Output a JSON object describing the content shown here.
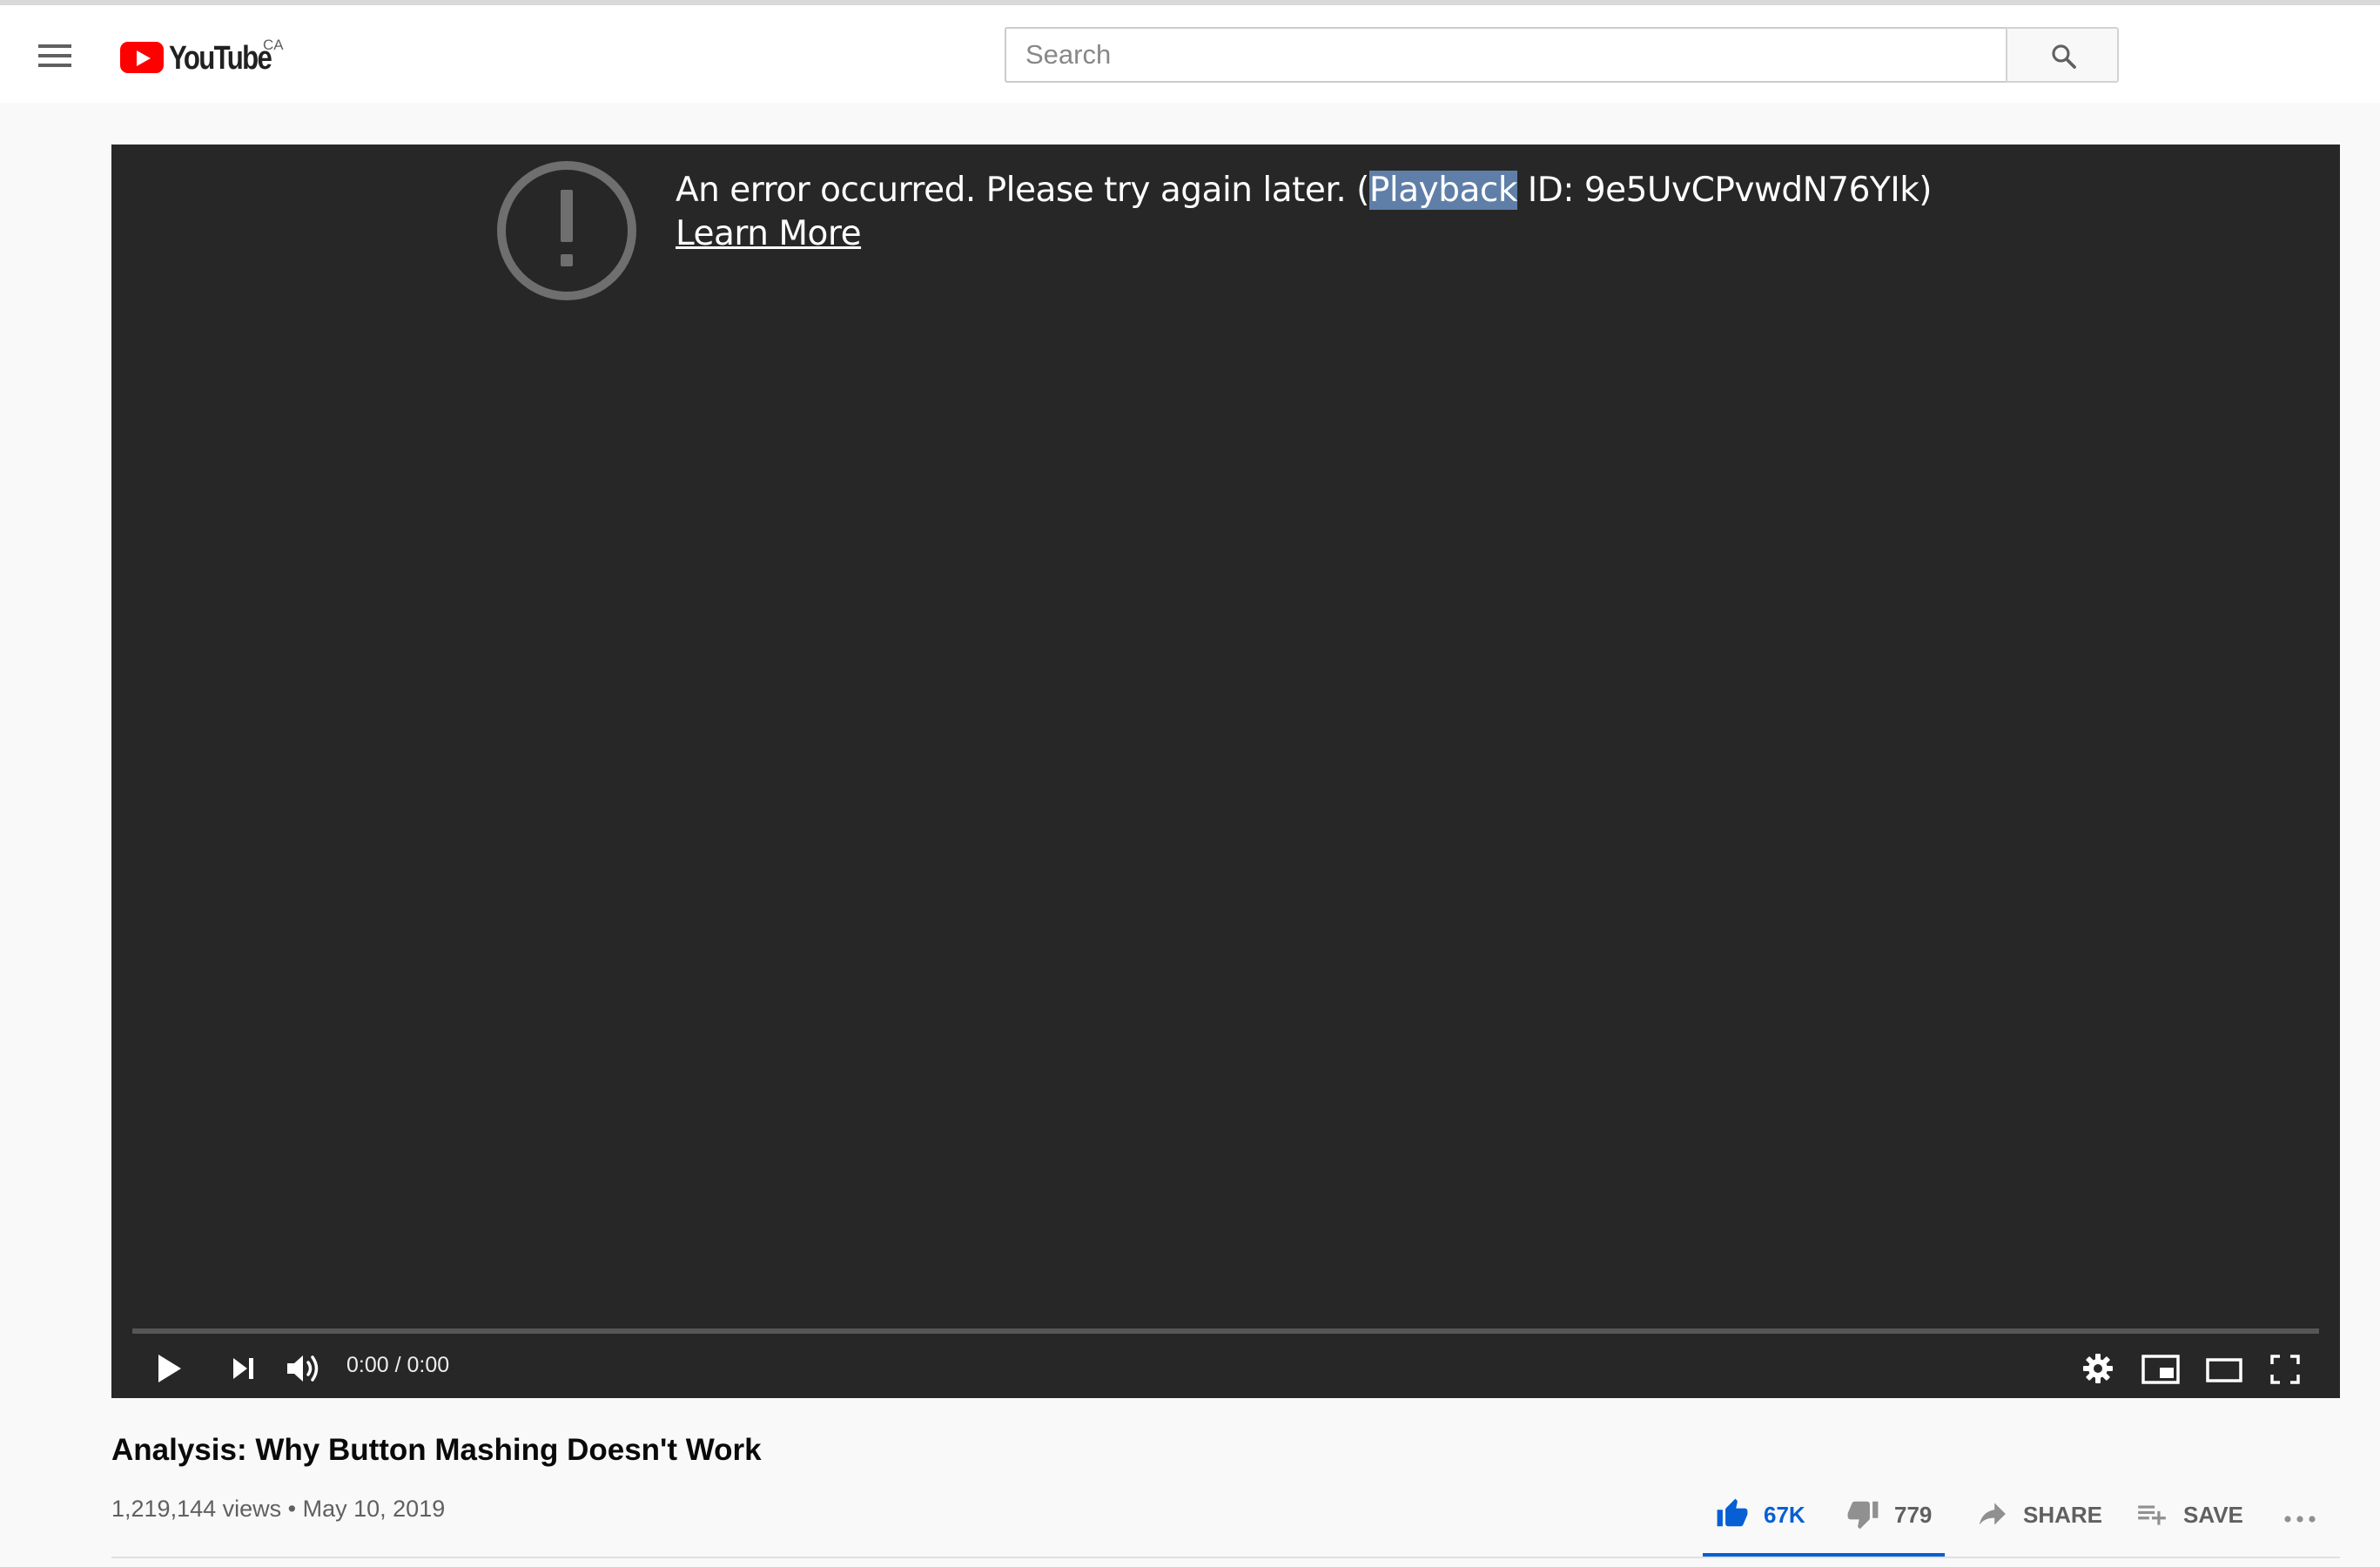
{
  "masthead": {
    "logo_text": "YouTube",
    "region": "CA",
    "search_placeholder": "Search"
  },
  "player": {
    "error_text_before": "An error occurred. Please try again later. (",
    "error_highlighted": "Playback",
    "error_text_after": " ID: 9e5UvCPvwdN76YIk)",
    "learn_more": "Learn More",
    "time_display": "0:00 / 0:00",
    "progress": 0
  },
  "video": {
    "title": "Analysis: Why Button Mashing Doesn't Work",
    "views": "1,219,144 views",
    "separator": "•",
    "date": "May 10, 2019"
  },
  "actions": {
    "likes": "67K",
    "dislikes": "779",
    "share": "SHARE",
    "save": "SAVE"
  },
  "colors": {
    "accent": "#065fd4",
    "brand": "#ff0000",
    "player_bg": "#272727",
    "text_highlight": "#5f7fa8"
  },
  "icons": [
    "menu-icon",
    "youtube-logo-icon",
    "search-icon",
    "error-icon",
    "play-icon",
    "next-icon",
    "volume-icon",
    "settings-icon",
    "miniplayer-icon",
    "theater-mode-icon",
    "fullscreen-icon",
    "thumbs-up-icon",
    "thumbs-down-icon",
    "share-icon",
    "save-playlist-icon",
    "more-icon"
  ]
}
